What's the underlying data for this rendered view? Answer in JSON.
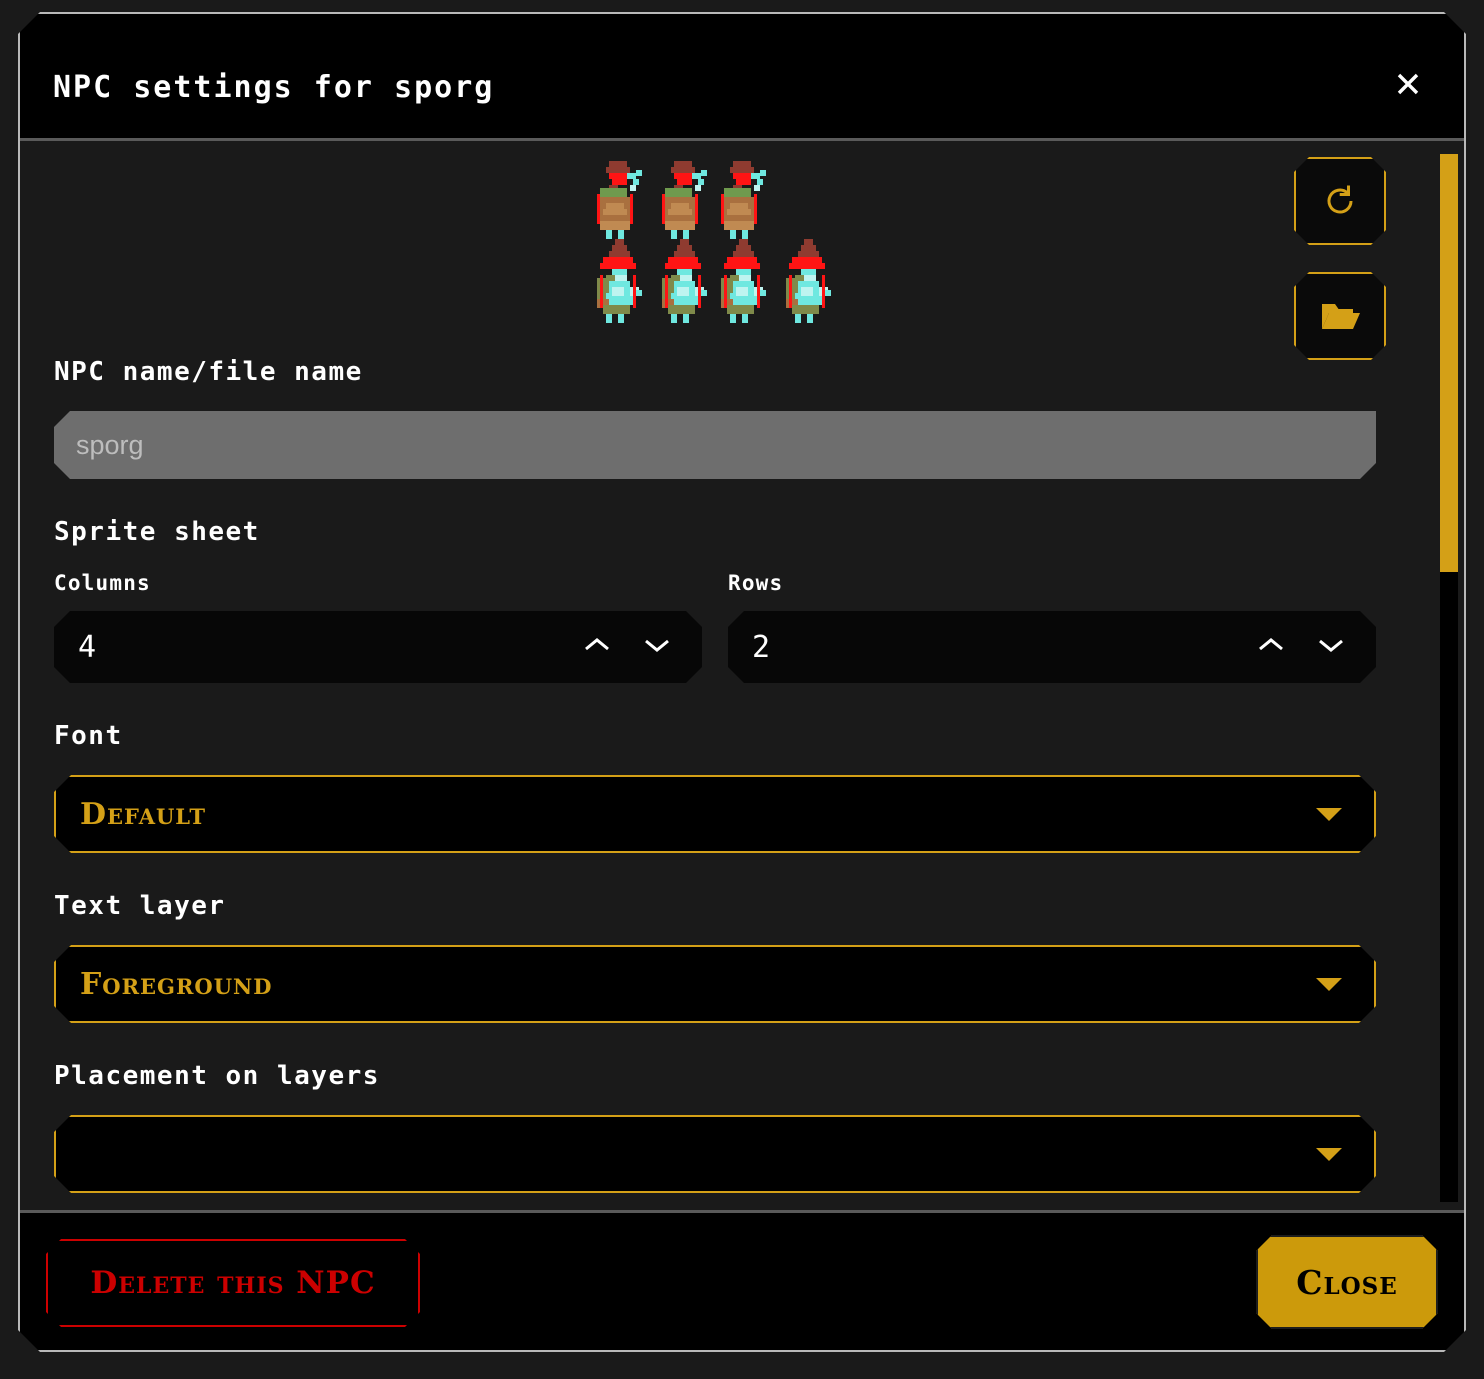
{
  "dialog": {
    "title": "NPC settings for sporg",
    "close_icon": "close-x-icon"
  },
  "preview": {
    "reload_icon": "refresh-icon",
    "open_folder_icon": "open-folder-icon",
    "sprite_columns": 4,
    "sprite_rows": 2,
    "sprite_palette": {
      "red": "#ff1414",
      "dark_red": "#8f3b30",
      "hat_red": "#d22",
      "green": "#6f9a4e",
      "olive": "#7f8a4a",
      "brown": "#a9703f",
      "tan": "#c08a52",
      "cyan": "#6fe8e0",
      "light_cyan": "#bff4f0",
      "background": "#121212"
    }
  },
  "name_field": {
    "label": "NPC name/file name",
    "placeholder": "sporg",
    "value": ""
  },
  "sprite_sheet": {
    "section_label": "Sprite sheet",
    "columns": {
      "label": "Columns",
      "value": "4"
    },
    "rows": {
      "label": "Rows",
      "value": "2"
    },
    "up_icon": "chevron-up-icon",
    "down_icon": "chevron-down-icon"
  },
  "font": {
    "label": "Font",
    "selected": "Default",
    "caret_icon": "caret-down-icon"
  },
  "text_layer": {
    "label": "Text layer",
    "selected": "Foreground",
    "caret_icon": "caret-down-icon"
  },
  "placement": {
    "label": "Placement on layers"
  },
  "footer": {
    "delete_label": "Delete this NPC",
    "close_label": "Close"
  },
  "colors": {
    "gold": "#d4a017",
    "gold_fill": "#cc9a0b",
    "danger": "#cc0000",
    "dialog_border": "#b9b9b9",
    "body_bg": "#1a1a1a",
    "header_bg": "#000000"
  },
  "scrollbar": {
    "thumb_color": "#d4a017",
    "track_color": "#000000"
  }
}
